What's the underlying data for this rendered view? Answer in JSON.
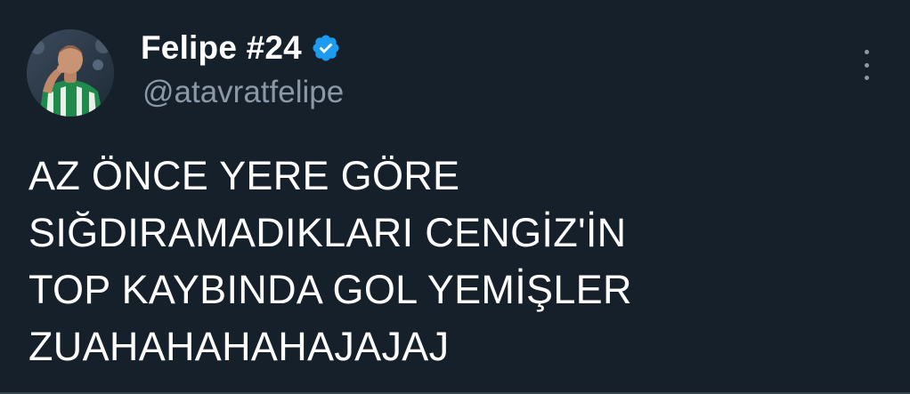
{
  "tweet": {
    "display_name": "Felipe #24",
    "handle": "@atavratfelipe",
    "verified": true,
    "verified_icon": "verified-badge-icon",
    "more_icon": "more-vertical-icon",
    "text_lines": [
      "AZ ÖNCE YERE GÖRE",
      "SIĞDIRAMADIKLARI CENGİZ'İN",
      "TOP KAYBINDA GOL YEMİŞLER",
      "ZUAHAHAHAHAJAJAJ"
    ]
  },
  "colors": {
    "background": "#15202b",
    "text": "#ffffff",
    "secondary_text": "#8b98a5",
    "verified_blue": "#1d9bf0"
  }
}
